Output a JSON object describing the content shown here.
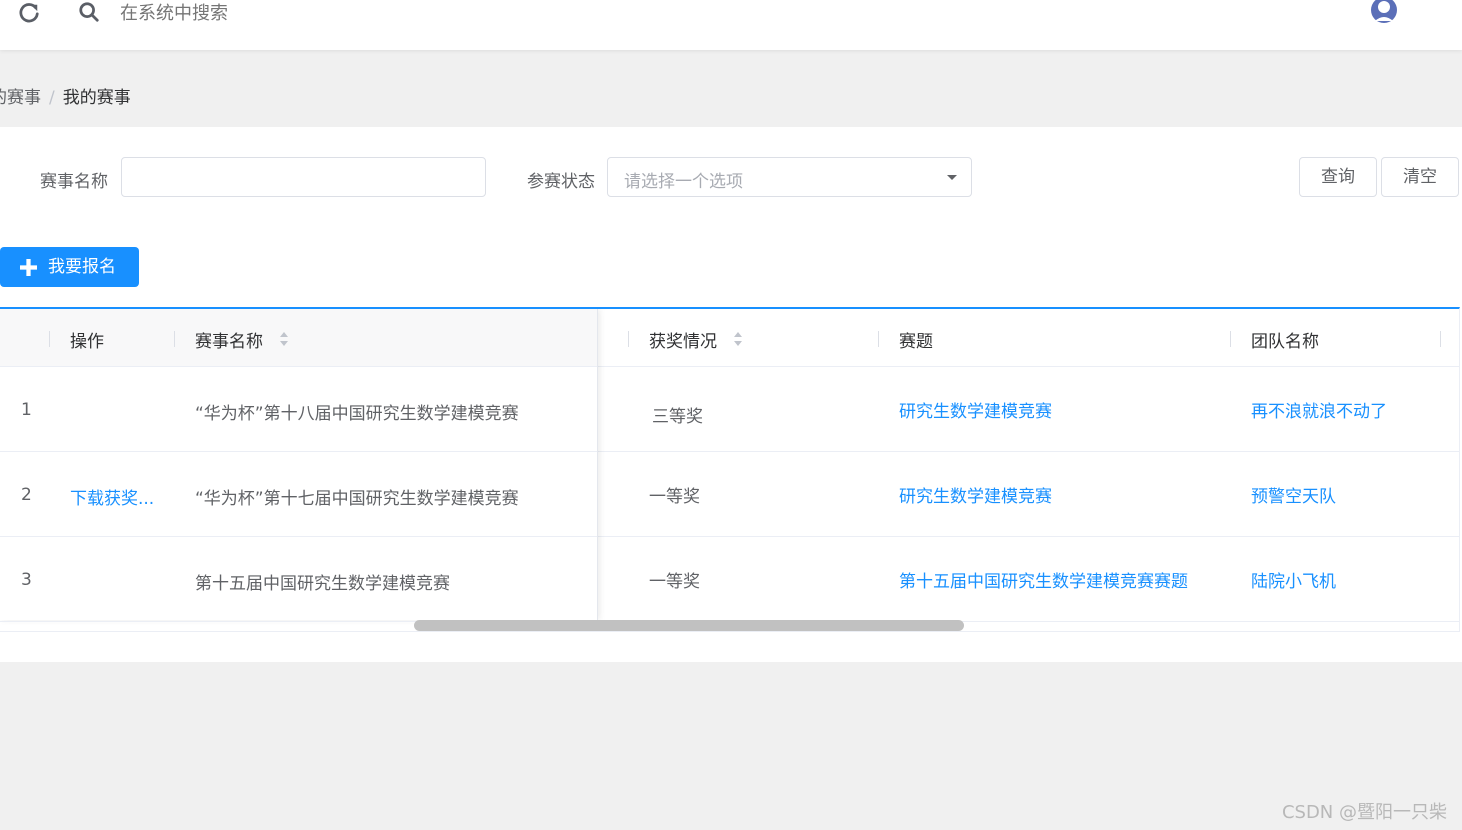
{
  "topbar": {
    "search_placeholder": "在系统中搜索"
  },
  "breadcrumb": {
    "parent": "的赛事",
    "separator": "/",
    "current": "我的赛事"
  },
  "filters": {
    "name_label": "赛事名称",
    "name_value": "",
    "status_label": "参赛状态",
    "status_placeholder": "请选择一个选项",
    "query_button": "查询",
    "clear_button": "清空"
  },
  "register_button": "我要报名",
  "table": {
    "headers": {
      "action": "操作",
      "name": "赛事名称",
      "award": "获奖情况",
      "topic": "赛题",
      "team": "团队名称"
    },
    "rows": [
      {
        "index": "1",
        "action": "",
        "name": "“华为杯”第十八届中国研究生数学建模竞赛",
        "award": "三等奖",
        "topic": "研究生数学建模竞赛",
        "team": "再不浪就浪不动了"
      },
      {
        "index": "2",
        "action": "下载获奖...",
        "name": "“华为杯”第十七届中国研究生数学建模竞赛",
        "award": "一等奖",
        "topic": "研究生数学建模竞赛",
        "team": "预警空天队"
      },
      {
        "index": "3",
        "action": "",
        "name": "第十五届中国研究生数学建模竞赛",
        "award": "一等奖",
        "topic": "第十五届中国研究生数学建模竞赛赛题",
        "team": "陆院小飞机"
      }
    ]
  },
  "watermark": "CSDN @暨阳一只柴",
  "colors": {
    "primary": "#1890ff",
    "background": "#f0f0f0",
    "link": "#1890ff"
  }
}
